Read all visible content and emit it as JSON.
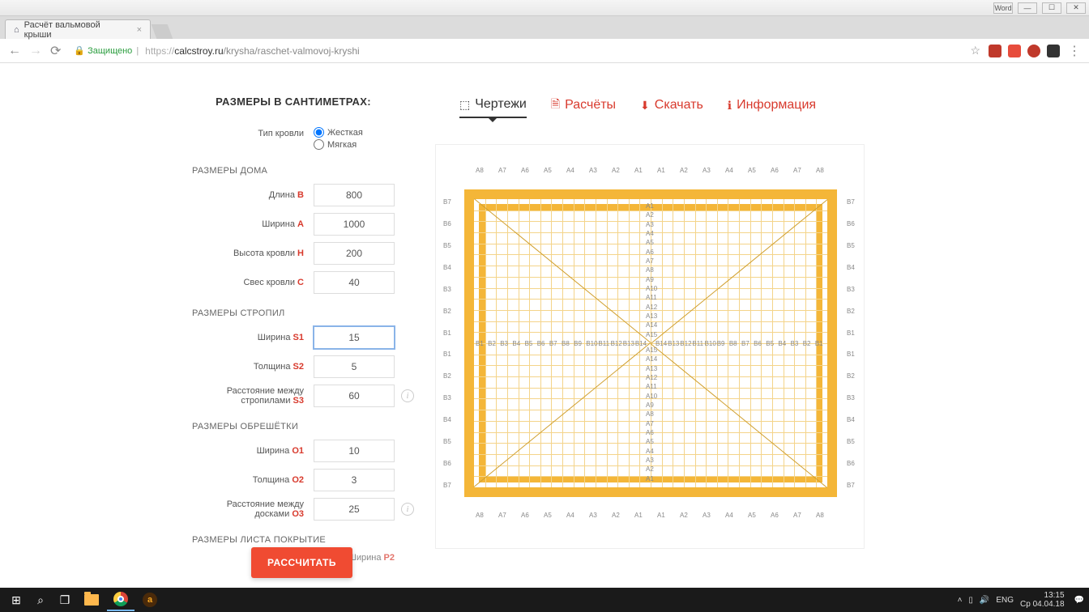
{
  "win": {
    "word": "Word"
  },
  "browser": {
    "tab_title": "Расчёт вальмовой крыши",
    "secure_label": "Защищено",
    "url_host": "https://",
    "url_domain": "calcstroy.ru",
    "url_path": "/krysha/raschet-valmovoj-kryshi"
  },
  "form": {
    "title": "РАЗМЕРЫ В САНТИМЕТРАХ:",
    "roof_type_label": "Тип кровли",
    "roof_type_opt1": "Жесткая",
    "roof_type_opt2": "Мягкая",
    "sec_house": "РАЗМЕРЫ ДОМА",
    "length_label": "Длина ",
    "length_letter": "B",
    "length_val": "800",
    "width_label": "Ширина ",
    "width_letter": "A",
    "width_val": "1000",
    "height_label": "Высота кровли ",
    "height_letter": "H",
    "height_val": "200",
    "overhang_label": "Свес кровли ",
    "overhang_letter": "C",
    "overhang_val": "40",
    "sec_rafters": "РАЗМЕРЫ СТРОПИЛ",
    "r_width_label": "Ширина ",
    "r_width_letter": "S1",
    "r_width_val": "15",
    "r_thick_label": "Толщина ",
    "r_thick_letter": "S2",
    "r_thick_val": "5",
    "r_dist_label": "Расстояние между стропилами ",
    "r_dist_letter": "S3",
    "r_dist_val": "60",
    "sec_lath": "РАЗМЕРЫ ОБРЕШЁТКИ",
    "l_width_label": "Ширина ",
    "l_width_letter": "O1",
    "l_width_val": "10",
    "l_thick_label": "Толщина ",
    "l_thick_letter": "O2",
    "l_thick_val": "3",
    "l_dist_label": "Расстояние между досками ",
    "l_dist_letter": "O3",
    "l_dist_val": "25",
    "sec_sheet": "РАЗМЕРЫ ЛИСТА ПОКРЫТИЕ",
    "sheet_width_label": "Ширина ",
    "sheet_width_letter": "P2",
    "calc_btn": "РАССЧИТАТЬ"
  },
  "tabs": {
    "drawings": "Чертежи",
    "calc": "Расчёты",
    "download": "Скачать",
    "info": "Информация"
  },
  "taskbar": {
    "lang": "ENG",
    "time": "13:15",
    "date": "Ср 04.04.18"
  }
}
